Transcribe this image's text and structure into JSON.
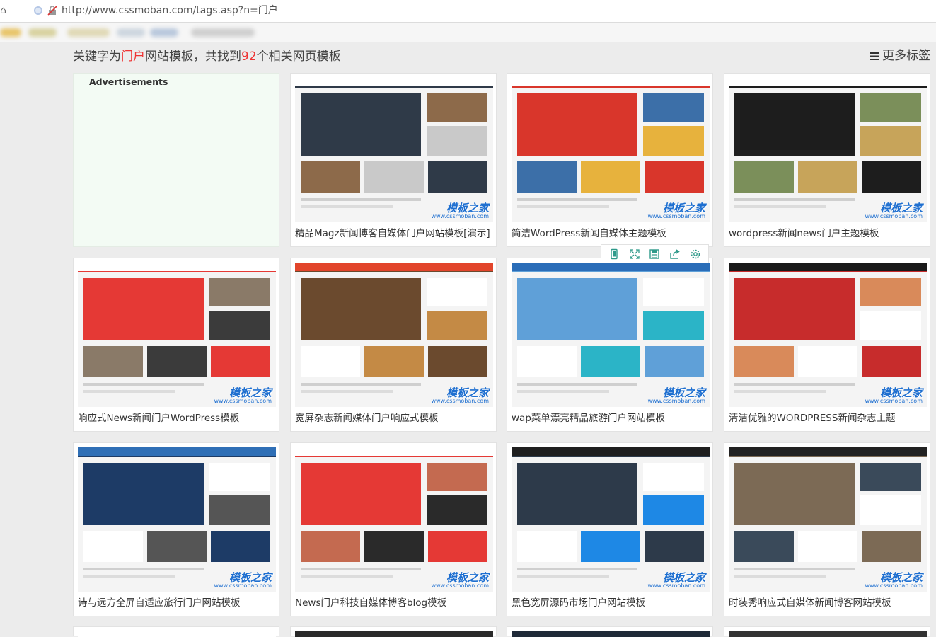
{
  "browser": {
    "url": "http://www.cssmoban.com/tags.asp?n=门户"
  },
  "page": {
    "heading_prefix": "关键字为",
    "keyword": "门户",
    "heading_middle": "网站模板，共找到",
    "count": "92",
    "heading_suffix": "个相关网页模板",
    "more_tags": "更多标签"
  },
  "ad": {
    "label": "Advertisements"
  },
  "watermark": {
    "cn": "模板之家",
    "url": "www.cssmoban.com"
  },
  "templates": [
    {
      "title": "精品Magz新闻博客自媒体门户网站模板[演示]",
      "colors": [
        "#ffffff",
        "#2f3a48",
        "#8d6a4a",
        "#c9c9c9"
      ],
      "has_watermark": true
    },
    {
      "title": "简洁WordPress新闻自媒体主题模板",
      "colors": [
        "#ffffff",
        "#d9362b",
        "#3c6fa8",
        "#e7b23d"
      ],
      "has_watermark": true
    },
    {
      "title": "wordpress新闻news门户主题模板",
      "colors": [
        "#ffffff",
        "#1d1d1d",
        "#7b8f5a",
        "#c7a45a"
      ],
      "has_watermark": true
    },
    {
      "title": "响应式News新闻门户WordPress模板",
      "colors": [
        "#ffffff",
        "#e53935",
        "#8a7a68",
        "#3b3b3b"
      ],
      "has_watermark": true
    },
    {
      "title": "宽屏杂志新闻媒体门户响应式模板",
      "colors": [
        "#e2452b",
        "#6b4a2e",
        "#ffffff",
        "#c48a45"
      ],
      "has_watermark": true
    },
    {
      "title": "wap菜单漂亮精品旅游门户网站模板",
      "colors": [
        "#2a6db8",
        "#5fa0d8",
        "#ffffff",
        "#2bb4c7"
      ],
      "has_watermark": true
    },
    {
      "title": "清洁优雅的WORDPRESS新闻杂志主题",
      "colors": [
        "#1a1a1a",
        "#c72c2c",
        "#d98a5a",
        "#ffffff"
      ],
      "has_watermark": true
    },
    {
      "title": "诗与远方全屏自适应旅行门户网站模板",
      "colors": [
        "#2f6fb6",
        "#1d3b66",
        "#ffffff",
        "#555555"
      ],
      "has_watermark": true
    },
    {
      "title": "News门户科技自媒体博客blog模板",
      "colors": [
        "#ffffff",
        "#e53935",
        "#c46a50",
        "#2a2a2a"
      ],
      "has_watermark": true
    },
    {
      "title": "黑色宽屏源码市场门户网站模板",
      "colors": [
        "#1f1f1f",
        "#2d3a4a",
        "#ffffff",
        "#1e88e5"
      ],
      "has_watermark": true
    },
    {
      "title": "时装秀响应式自媒体新闻博客网站模板",
      "colors": [
        "#222222",
        "#7c6a55",
        "#3a4a5a",
        "#ffffff"
      ],
      "has_watermark": true
    }
  ],
  "toolbar_icons": [
    "mobile-icon",
    "fullscreen-icon",
    "save-icon",
    "share-icon",
    "settings-icon"
  ]
}
